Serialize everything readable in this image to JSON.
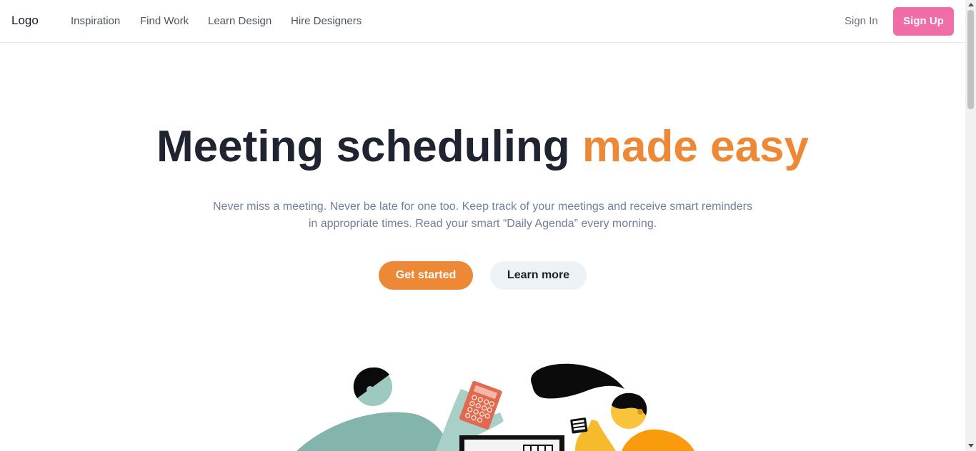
{
  "nav": {
    "logo": "Logo",
    "links": [
      "Inspiration",
      "Find Work",
      "Learn Design",
      "Hire Designers"
    ],
    "sign_in": "Sign In",
    "sign_up": "Sign Up"
  },
  "hero": {
    "title_main": "Meeting scheduling ",
    "title_accent": "made easy",
    "subtitle": "Never miss a meeting. Never be late for one too. Keep track of your meetings and receive smart reminders in appropriate times. Read your smart “Daily Agenda” every morning.",
    "primary_button": "Get started",
    "secondary_button": "Learn more"
  },
  "colors": {
    "accent": "#ed8936",
    "signup": "#f06da8",
    "heading": "#1f2430",
    "subtitle": "#718096"
  }
}
